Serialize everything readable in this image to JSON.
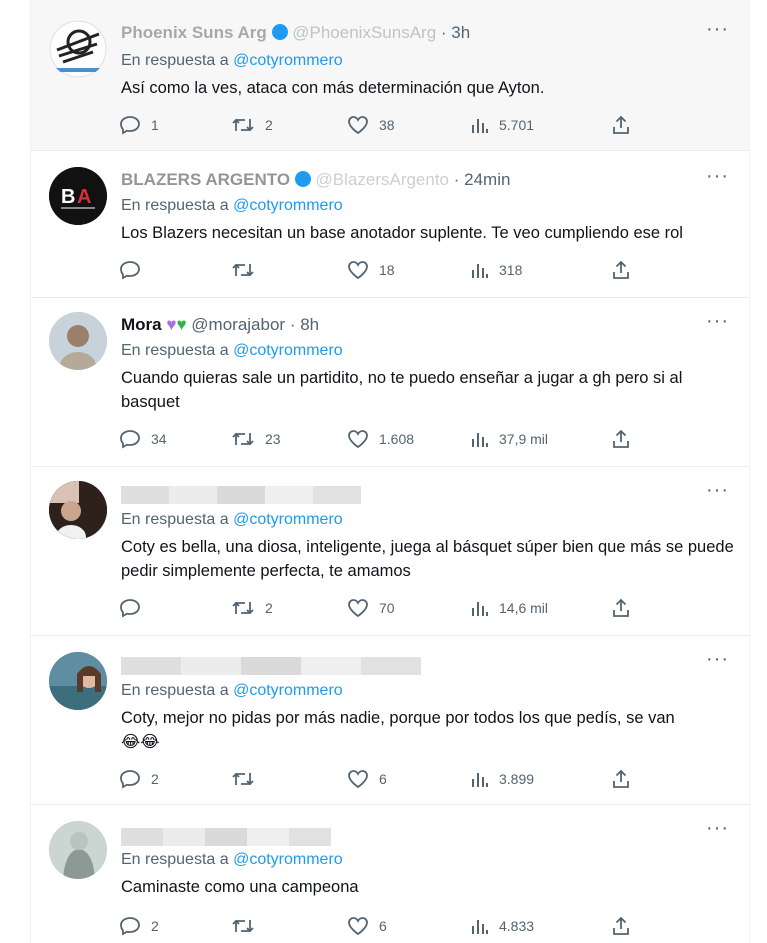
{
  "replies": [
    {
      "name": "Phoenix Suns Arg",
      "handle": "@PhoenixSunsArg",
      "time": "· 3h",
      "reply_prefix": "En respuesta a",
      "mention": "@cotyrommero",
      "text": "Así como la ves, ataca con más determinación que Ayton.",
      "replies_count": "1",
      "retweets_count": "2",
      "likes_count": "38",
      "views_count": "5.701"
    },
    {
      "name": "BLAZERS ARGENTO",
      "handle": "@BlazersArgento",
      "time": "· 24min",
      "reply_prefix": "En respuesta a",
      "mention": "@cotyrommero",
      "text": "Los Blazers necesitan un base anotador suplente. Te veo cumpliendo ese rol",
      "replies_count": "",
      "retweets_count": "",
      "likes_count": "18",
      "views_count": "318"
    },
    {
      "name": "Mora",
      "handle": "@morajabor",
      "time": "· 8h",
      "reply_prefix": "En respuesta a",
      "mention": "@cotyrommero",
      "text": "Cuando quieras sale un partidito, no te puedo enseñar a jugar a gh pero si al basquet",
      "replies_count": "34",
      "retweets_count": "23",
      "likes_count": "1.608",
      "views_count": "37,9 mil"
    },
    {
      "reply_prefix": "En respuesta a",
      "mention": "@cotyrommero",
      "text": "Coty es bella, una diosa, inteligente, juega al básquet súper bien que más se puede pedir simplemente perfecta, te amamos",
      "replies_count": "",
      "retweets_count": "2",
      "likes_count": "70",
      "views_count": "14,6 mil"
    },
    {
      "reply_prefix": "En respuesta a",
      "mention": "@cotyrommero",
      "text": "Coty, mejor no pidas por más nadie, porque por todos los que pedís, se van",
      "emojis": "😂😂",
      "replies_count": "2",
      "retweets_count": "",
      "likes_count": "6",
      "views_count": "3.899"
    },
    {
      "reply_prefix": "En respuesta a",
      "mention": "@cotyrommero",
      "text": "Caminaste como una campeona",
      "replies_count": "2",
      "retweets_count": "",
      "likes_count": "6",
      "views_count": "4.833"
    }
  ],
  "more_glyph": "···",
  "icons": [
    "reply-icon",
    "retweet-icon",
    "like-icon",
    "views-icon",
    "share-icon"
  ],
  "colors": {
    "link": "#1d9bf0",
    "muted": "#536471",
    "text": "#0f1419",
    "highlight_bg": "#f7f7f7",
    "verified": "#1d9bf0"
  }
}
